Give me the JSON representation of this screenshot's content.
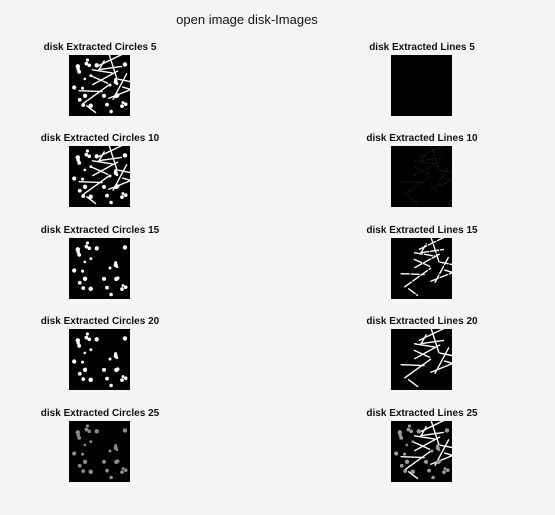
{
  "figure": {
    "title": "open image disk-Images"
  },
  "panels": [
    {
      "title": "disk Extracted Circles 5",
      "image": "circles-and-lines-full",
      "brightness": "high"
    },
    {
      "title": "disk Extracted Lines 5",
      "image": "nearly-black",
      "brightness": "none"
    },
    {
      "title": "disk Extracted Circles 10",
      "image": "circles-and-lines-full",
      "brightness": "high"
    },
    {
      "title": "disk Extracted Lines 10",
      "image": "faint-line-traces",
      "brightness": "faint"
    },
    {
      "title": "disk Extracted Circles 15",
      "image": "circles-only",
      "brightness": "high"
    },
    {
      "title": "disk Extracted Lines 15",
      "image": "lines-only",
      "brightness": "high"
    },
    {
      "title": "disk Extracted Circles 20",
      "image": "circles-only",
      "brightness": "high"
    },
    {
      "title": "disk Extracted Lines 20",
      "image": "lines-only",
      "brightness": "high"
    },
    {
      "title": "disk Extracted Circles 25",
      "image": "circles-only",
      "brightness": "dim"
    },
    {
      "title": "disk Extracted Lines 25",
      "image": "lines-with-dots",
      "brightness": "high"
    }
  ],
  "colors": {
    "background": "#f5f5f5",
    "image_background": "#000000",
    "foreground": "#ffffff"
  }
}
